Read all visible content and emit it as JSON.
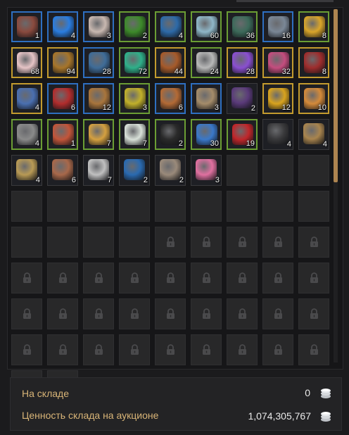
{
  "warehouse": {
    "stored_label": "На складе",
    "stored_value": "0",
    "market_value_label": "Ценность склада на аукционе",
    "market_value": "1,074,305,767",
    "coin_icon": "silver-coins-icon"
  },
  "scrollbar": {
    "thumb_color": "#ad8450"
  },
  "colors": {
    "blue_border": "#2e6fc1",
    "green_border": "#6b9d34",
    "gold_border": "#c39b2e",
    "label_gold": "#d8b477"
  },
  "items": [
    {
      "icon": "chest-icon",
      "qty": "1",
      "border": "blue",
      "color": "#8a4a3e"
    },
    {
      "icon": "blue-magic-icon",
      "qty": "4",
      "border": "blue",
      "color": "#2a7de0"
    },
    {
      "icon": "white-stone-icon",
      "qty": "3",
      "border": "blue",
      "color": "#c8b8b0"
    },
    {
      "icon": "herb-icon",
      "qty": "2",
      "border": "green",
      "color": "#3d8a2a"
    },
    {
      "icon": "blue-flask-icon",
      "qty": "4",
      "border": "green",
      "color": "#2d6aa8"
    },
    {
      "icon": "key-icon",
      "qty": "60",
      "border": "green",
      "color": "#8fb7c8"
    },
    {
      "icon": "green-key-icon",
      "qty": "36",
      "border": "green",
      "color": "#3c6a5a"
    },
    {
      "icon": "gray-ore-icon",
      "qty": "16",
      "border": "blue",
      "color": "#7a8796"
    },
    {
      "icon": "gold-coins-icon",
      "qty": "8",
      "border": "green",
      "color": "#d9a52a"
    },
    {
      "icon": "seashell-icon",
      "qty": "68",
      "border": "gold",
      "color": "#e6c4c6"
    },
    {
      "icon": "treasure-chest-icon",
      "qty": "94",
      "border": "gold",
      "color": "#a7752a"
    },
    {
      "icon": "blue-cloth-icon",
      "qty": "28",
      "border": "blue",
      "color": "#3f6c98"
    },
    {
      "icon": "emerald-icon",
      "qty": "72",
      "border": "green",
      "color": "#2fb08a"
    },
    {
      "icon": "hide-icon",
      "qty": "44",
      "border": "gold",
      "color": "#a65a2a"
    },
    {
      "icon": "dagger-icon",
      "qty": "24",
      "border": "green",
      "color": "#b8b8b8"
    },
    {
      "icon": "amethyst-icon",
      "qty": "28",
      "border": "gold",
      "color": "#8a4fd0"
    },
    {
      "icon": "rainbow-ingot-icon",
      "qty": "32",
      "border": "gold",
      "color": "#c44d7e"
    },
    {
      "icon": "knife-icon",
      "qty": "8",
      "border": "gold",
      "color": "#9e2d2d"
    },
    {
      "icon": "crystal-orb-icon",
      "qty": "4",
      "border": "gold",
      "color": "#4a6fb0"
    },
    {
      "icon": "red-potion-icon",
      "qty": "6",
      "border": "blue",
      "color": "#b22d2d"
    },
    {
      "icon": "brown-ore-icon",
      "qty": "12",
      "border": "blue",
      "color": "#a8753c"
    },
    {
      "icon": "goggles-icon",
      "qty": "3",
      "border": "green",
      "color": "#c1b02a"
    },
    {
      "icon": "crate-icon",
      "qty": "6",
      "border": "blue",
      "color": "#b36a35"
    },
    {
      "icon": "rock-icon",
      "qty": "3",
      "border": "blue",
      "color": "#a58c6a"
    },
    {
      "icon": "dark-dagger-icon",
      "qty": "2",
      "border": "plain",
      "color": "#5a3a7a"
    },
    {
      "icon": "gold-medal-icon",
      "qty": "12",
      "border": "gold",
      "color": "#d8a31e"
    },
    {
      "icon": "gift-box-icon",
      "qty": "10",
      "border": "gold",
      "color": "#d48a3a"
    },
    {
      "icon": "stone-pile-icon",
      "qty": "4",
      "border": "green",
      "color": "#8a8a8a"
    },
    {
      "icon": "coral-icon",
      "qty": "1",
      "border": "green",
      "color": "#c2553a"
    },
    {
      "icon": "gold-nugget-icon",
      "qty": "7",
      "border": "green",
      "color": "#d4a040"
    },
    {
      "icon": "pearl-icon",
      "qty": "7",
      "border": "green",
      "color": "#d8e0d8"
    },
    {
      "icon": "pirate-flag-icon",
      "qty": "2",
      "border": "green",
      "color": "#2a2a2a"
    },
    {
      "icon": "blue-slime-icon",
      "qty": "30",
      "border": "green",
      "color": "#3a78c8"
    },
    {
      "icon": "red-emblem-icon",
      "qty": "19",
      "border": "green",
      "color": "#c0262a"
    },
    {
      "icon": "coal-icon",
      "qty": "4",
      "border": "plain",
      "color": "#3a3a3c"
    },
    {
      "icon": "seed-bag-icon",
      "qty": "4",
      "border": "plain",
      "color": "#a8844e"
    },
    {
      "icon": "herb-sack-icon",
      "qty": "4",
      "border": "plain",
      "color": "#b89a55"
    },
    {
      "icon": "ore-cluster-icon",
      "qty": "6",
      "border": "plain",
      "color": "#a8684a"
    },
    {
      "icon": "silver-bar-icon",
      "qty": "7",
      "border": "plain",
      "color": "#c0c0c0"
    },
    {
      "icon": "blue-flower-icon",
      "qty": "2",
      "border": "plain",
      "color": "#2a6ab0"
    },
    {
      "icon": "shell-fossil-icon",
      "qty": "2",
      "border": "plain",
      "color": "#9a8a7a"
    },
    {
      "icon": "rainbow-coral-icon",
      "qty": "3",
      "border": "plain",
      "color": "#e070a0"
    }
  ],
  "empty_slot_count": 16,
  "locked_slot_count": 34,
  "lock_icon": "lock-icon"
}
